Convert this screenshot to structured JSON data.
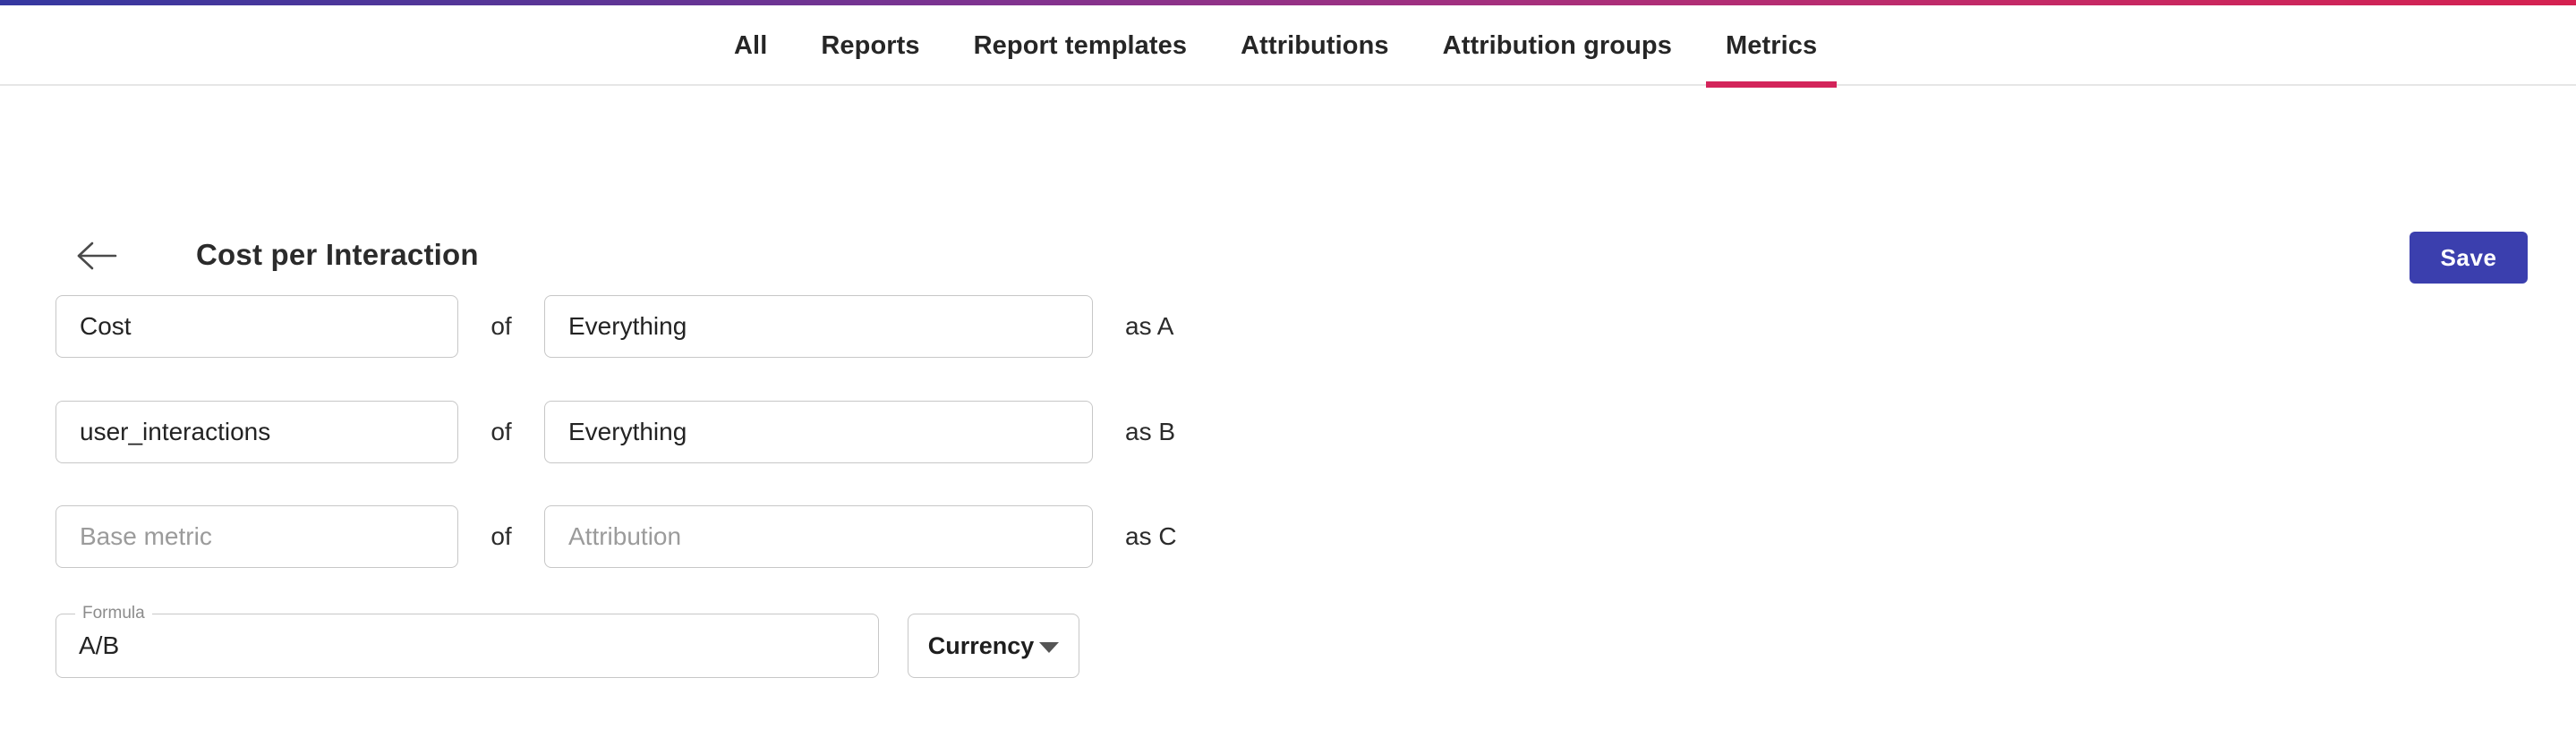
{
  "theme": {
    "gradient_start": "#3538a0",
    "gradient_end": "#d52150",
    "active_tab_underline": "#d3245a",
    "save_button_bg": "#3b3fae",
    "field_border": "#c7c7c7",
    "placeholder_color": "#9b9b9b"
  },
  "tabs": [
    {
      "label": "All",
      "active": false
    },
    {
      "label": "Reports",
      "active": false
    },
    {
      "label": "Report templates",
      "active": false
    },
    {
      "label": "Attributions",
      "active": false
    },
    {
      "label": "Attribution groups",
      "active": false
    },
    {
      "label": "Metrics",
      "active": true
    }
  ],
  "header": {
    "back_icon": "arrow-left-icon",
    "title": "Cost per Interaction",
    "save_label": "Save"
  },
  "form": {
    "rows": [
      {
        "base_metric": {
          "value": "Cost",
          "placeholder": "Base metric",
          "is_placeholder": false
        },
        "connector": "of",
        "attribution": {
          "value": "Everything",
          "placeholder": "Attribution",
          "is_placeholder": false
        },
        "alias": "as A"
      },
      {
        "base_metric": {
          "value": "user_interactions",
          "placeholder": "Base metric",
          "is_placeholder": false
        },
        "connector": "of",
        "attribution": {
          "value": "Everything",
          "placeholder": "Attribution",
          "is_placeholder": false
        },
        "alias": "as B"
      },
      {
        "base_metric": {
          "value": "Base metric",
          "placeholder": "Base metric",
          "is_placeholder": true
        },
        "connector": "of",
        "attribution": {
          "value": "Attribution",
          "placeholder": "Attribution",
          "is_placeholder": true
        },
        "alias": "as C"
      }
    ],
    "formula": {
      "label": "Formula",
      "value": "A/B"
    },
    "currency": {
      "label": "Currency",
      "caret_icon": "caret-down-icon"
    }
  }
}
